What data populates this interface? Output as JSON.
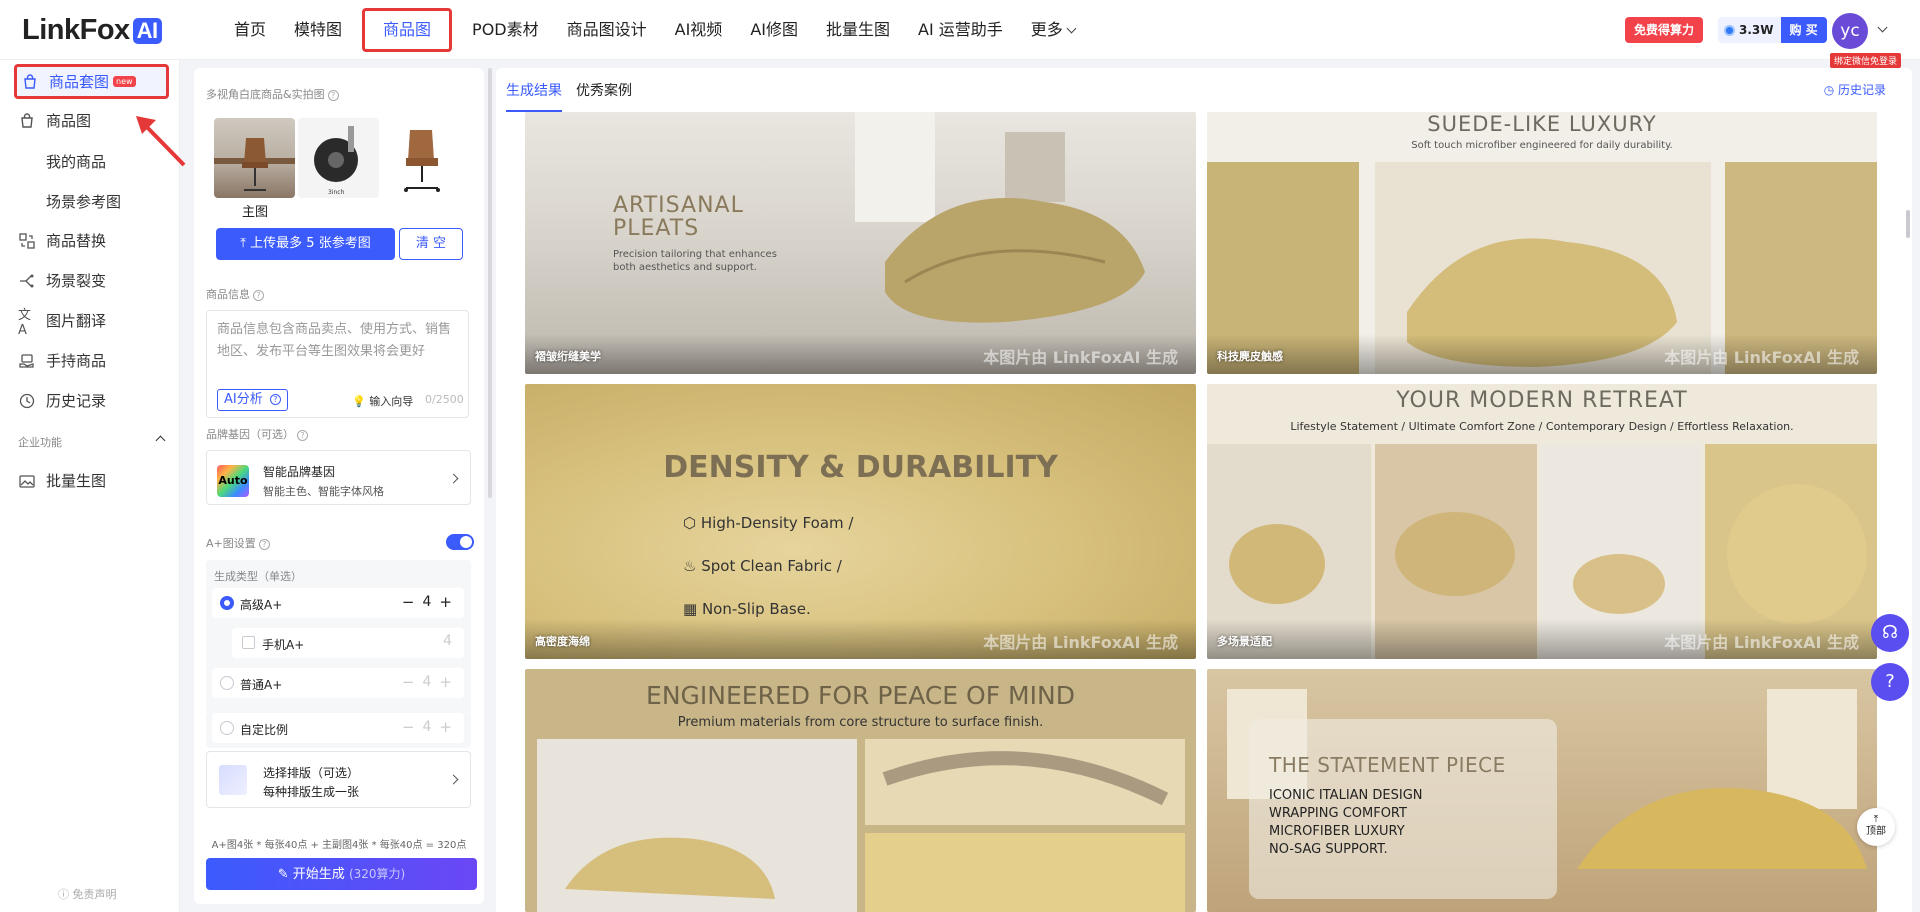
{
  "logo": {
    "text": "LinkFox",
    "ai": "AI"
  },
  "nav": {
    "items": [
      "首页",
      "模特图",
      "商品图",
      "POD素材",
      "商品图设计",
      "AI视频",
      "AI修图",
      "批量生图",
      "AI 运营助手",
      "更多"
    ],
    "active": "商品图"
  },
  "topright": {
    "free": "免费得算力",
    "credit": "3.3W",
    "buy": "购 买",
    "avatar": "yc",
    "bind_tag": "绑定微信免登录"
  },
  "sidebar": {
    "items": [
      {
        "label": "商品套图",
        "badge": "new",
        "active": true
      },
      {
        "label": "商品图"
      },
      {
        "label": "我的商品"
      },
      {
        "label": "场景参考图"
      },
      {
        "label": "商品替换"
      },
      {
        "label": "场景裂变"
      },
      {
        "label": "图片翻译"
      },
      {
        "label": "手持商品"
      },
      {
        "label": "历史记录"
      }
    ],
    "section": "企业功能",
    "batch": "批量生图",
    "disclaimer": "免责声明"
  },
  "panel": {
    "ref_label": "多视角白底商品&实拍图",
    "main_caption": "主图",
    "upload": "上传最多 5 张参考图",
    "clear": "清 空",
    "info_label": "商品信息",
    "info_placeholder": "商品信息包含商品卖点、使用方式、销售地区、发布平台等生图效果将会更好",
    "ai_analyze": "AI分析",
    "input_guide": "输入向导",
    "count": "0/2500",
    "brand_label": "品牌基因（可选）",
    "brand_logo": "Auto",
    "brand_title": "智能品牌基因",
    "brand_sub": "智能主色、智能字体风格",
    "aplus_label": "A+图设置",
    "gen_type": "生成类型（单选）",
    "options": [
      {
        "label": "高级A+",
        "value": "4"
      },
      {
        "label": "手机A+",
        "value": "4"
      },
      {
        "label": "普通A+",
        "value": "4"
      },
      {
        "label": "自定比例",
        "value": "4"
      }
    ],
    "layout_t1": "选择排版（可选）",
    "layout_t2": "每种排版生成一张",
    "formula": "A+图4张 * 每张40点 + 主副图4张 * 每张40点 = 320点",
    "start": "开始生成",
    "start_sub": "(320算力)"
  },
  "main": {
    "tabs": [
      "生成结果",
      "优秀案例"
    ],
    "history": "历史记录",
    "watermark": "本图片由 LinkFoxAI 生成",
    "cards": [
      {
        "caption": "褶皱绗缝美学",
        "h1": "ARTISANAL",
        "h2": "PLEATS",
        "sub": "Precision tailoring that enhances both aesthetics and support."
      },
      {
        "caption": "科技麂皮触感",
        "h1": "SUEDE-LIKE LUXURY",
        "sub": "Soft touch microfiber engineered for daily durability."
      },
      {
        "caption": "高密度海绵",
        "h1": "DENSITY & DURABILITY",
        "bullets": [
          "High-Density Foam /",
          "Spot Clean Fabric /",
          "Non-Slip Base."
        ]
      },
      {
        "caption": "多场景适配",
        "h1": "YOUR MODERN RETREAT",
        "sub": "Lifestyle Statement / Ultimate Comfort Zone / Contemporary Design / Effortless Relaxation."
      },
      {
        "h1": "ENGINEERED FOR PEACE OF MIND",
        "sub": "Premium materials from core structure to surface finish."
      },
      {
        "h1": "THE STATEMENT PIECE",
        "lines": [
          "ICONIC ITALIAN DESIGN",
          "WRAPPING COMFORT",
          "MICROFIBER LUXURY",
          "NO-SAG SUPPORT."
        ]
      }
    ],
    "top": "顶部"
  },
  "colors": {
    "accent": "#3b5bfd",
    "highlight": "#e53939"
  }
}
